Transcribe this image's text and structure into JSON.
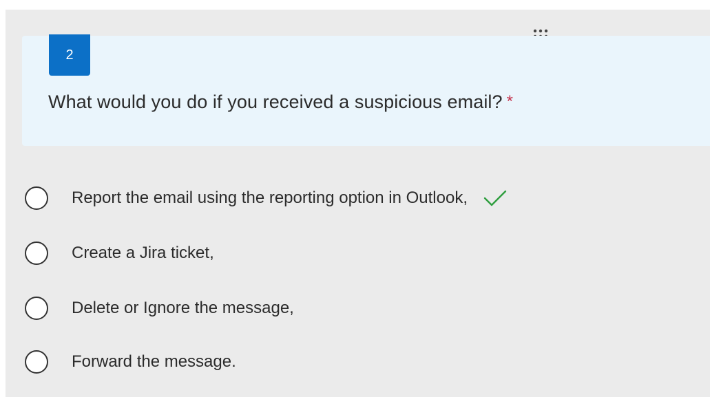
{
  "question": {
    "number": "2",
    "title": "What would you do if you received a suspicious email?",
    "required_marker": "*"
  },
  "options": [
    {
      "label": "Report the email using the reporting option in Outlook,",
      "correct": true
    },
    {
      "label": "Create a Jira ticket,",
      "correct": false
    },
    {
      "label": "Delete or Ignore the message,",
      "correct": false
    },
    {
      "label": "Forward the message.",
      "correct": false
    }
  ],
  "icons": {
    "drag": "drag-handle-icon",
    "correct": "checkmark-icon"
  },
  "colors": {
    "accent": "#0c70c7",
    "question_bg": "#eaf5fc",
    "card_bg": "#ebebeb",
    "required": "#c4314b",
    "check": "#2e9e3e"
  }
}
